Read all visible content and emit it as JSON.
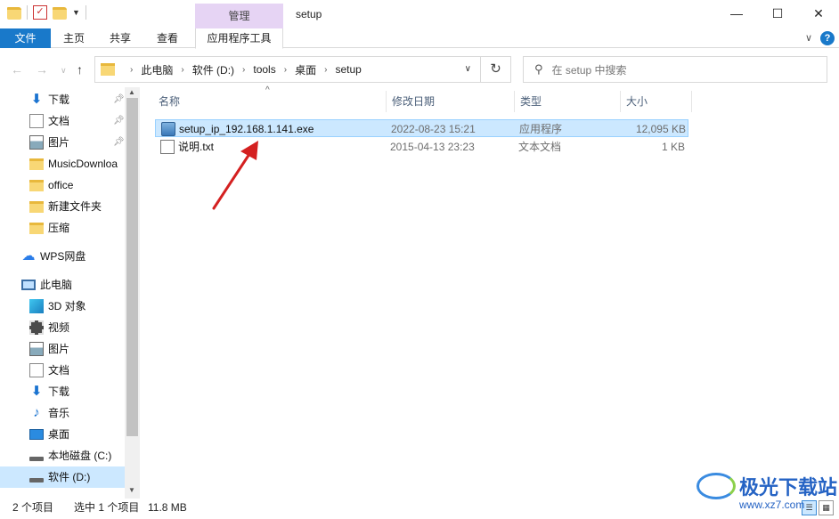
{
  "window": {
    "title": "setup",
    "manage_tab": "管理",
    "minimize": "—",
    "maximize": "☐",
    "close": "✕"
  },
  "ribbon": {
    "tabs": [
      "文件",
      "主页",
      "共享",
      "查看",
      "应用程序工具"
    ]
  },
  "address": {
    "crumbs": [
      "此电脑",
      "软件 (D:)",
      "tools",
      "桌面",
      "setup"
    ]
  },
  "search": {
    "placeholder": "在 setup 中搜索"
  },
  "nav": {
    "quick": [
      {
        "label": "下载",
        "icon": "download-icon",
        "pinned": true
      },
      {
        "label": "文档",
        "icon": "document-icon",
        "pinned": true
      },
      {
        "label": "图片",
        "icon": "pictures-icon",
        "pinned": true
      },
      {
        "label": "MusicDownloa",
        "icon": "folder-icon",
        "pinned": false
      },
      {
        "label": "office",
        "icon": "folder-icon",
        "pinned": false
      },
      {
        "label": "新建文件夹",
        "icon": "folder-icon",
        "pinned": false
      },
      {
        "label": "压缩",
        "icon": "folder-icon",
        "pinned": false
      }
    ],
    "wps": "WPS网盘",
    "this_pc": "此电脑",
    "pc_items": [
      {
        "label": "3D 对象",
        "icon": "3d-objects-icon"
      },
      {
        "label": "视频",
        "icon": "video-icon"
      },
      {
        "label": "图片",
        "icon": "pictures-icon"
      },
      {
        "label": "文档",
        "icon": "document-icon"
      },
      {
        "label": "下载",
        "icon": "download-icon"
      },
      {
        "label": "音乐",
        "icon": "music-icon"
      },
      {
        "label": "桌面",
        "icon": "desktop-icon"
      },
      {
        "label": "本地磁盘 (C:)",
        "icon": "drive-icon"
      },
      {
        "label": "软件 (D:)",
        "icon": "drive-icon"
      }
    ]
  },
  "columns": {
    "name": "名称",
    "date": "修改日期",
    "type": "类型",
    "size": "大小"
  },
  "files": [
    {
      "name": "setup_ip_192.168.1.141.exe",
      "date": "2022-08-23 15:21",
      "type": "应用程序",
      "size": "12,095 KB",
      "icon": "exe-icon",
      "selected": true
    },
    {
      "name": "说明.txt",
      "date": "2015-04-13 23:23",
      "type": "文本文档",
      "size": "1 KB",
      "icon": "text-file-icon",
      "selected": false
    }
  ],
  "status": {
    "count": "2 个项目",
    "selected": "选中 1 个项目",
    "size": "11.8 MB"
  },
  "watermark": {
    "name": "极光下载站",
    "url": "www.xz7.com"
  },
  "colors": {
    "accent": "#1979ca",
    "selection": "#cce8ff",
    "manage_tab": "#e6d4f4",
    "annotation_arrow": "#d42020"
  }
}
